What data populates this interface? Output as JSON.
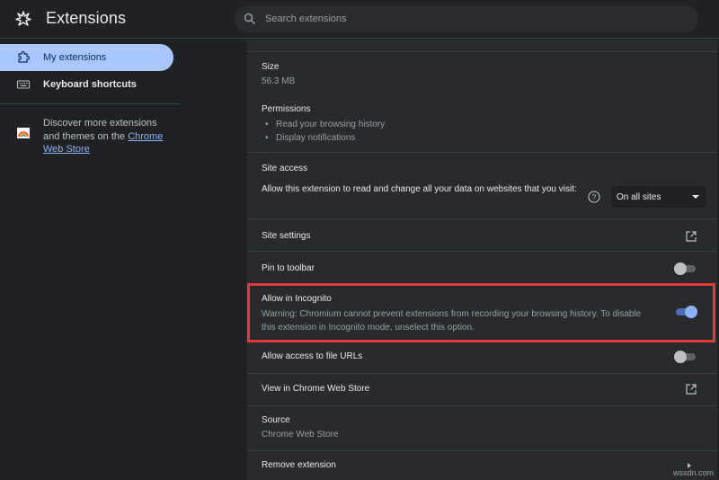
{
  "header": {
    "title": "Extensions",
    "search_placeholder": "Search extensions"
  },
  "sidebar": {
    "items": [
      {
        "label": "My extensions",
        "icon": "puzzle-icon",
        "active": true
      },
      {
        "label": "Keyboard shortcuts",
        "icon": "keyboard-icon",
        "active": false
      }
    ],
    "discover": {
      "text_before": "Discover more extensions and themes on the ",
      "link": "Chrome Web Store"
    }
  },
  "details": {
    "size_label": "Size",
    "size_value": "56.3 MB",
    "permissions_label": "Permissions",
    "permissions": [
      "Read your browsing history",
      "Display notifications"
    ],
    "site_access_label": "Site access",
    "site_access_desc": "Allow this extension to read and change all your data on websites that you visit:",
    "site_access_value": "On all sites",
    "site_settings_label": "Site settings",
    "pin_label": "Pin to toolbar",
    "pin_enabled": false,
    "incognito_label": "Allow in Incognito",
    "incognito_warning": "Warning: Chromium cannot prevent extensions from recording your browsing history. To disable this extension in Incognito mode, unselect this option.",
    "incognito_enabled": true,
    "file_urls_label": "Allow access to file URLs",
    "file_urls_enabled": false,
    "view_store_label": "View in Chrome Web Store",
    "source_label": "Source",
    "source_value": "Chrome Web Store",
    "remove_label": "Remove extension"
  },
  "colors": {
    "accent": "#a8c7fa",
    "highlight_border": "#e53935"
  },
  "watermark": "wsxdn.com"
}
